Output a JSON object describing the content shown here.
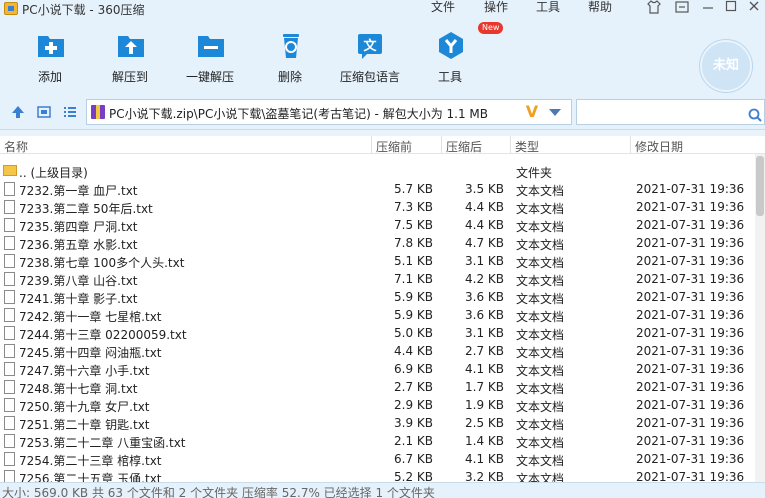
{
  "window": {
    "title": "PC小说下载 - 360压缩"
  },
  "menu": [
    "文件",
    "操作",
    "工具",
    "帮助"
  ],
  "toolbar": {
    "items": [
      {
        "label": "添加",
        "icon": "add-icon"
      },
      {
        "label": "解压到",
        "icon": "extract-to-icon"
      },
      {
        "label": "一键解压",
        "icon": "one-click-extract-icon"
      },
      {
        "label": "删除",
        "icon": "delete-icon"
      },
      {
        "label": "压缩包语言",
        "icon": "archive-language-icon"
      },
      {
        "label": "工具",
        "icon": "tools-icon",
        "badge": "New"
      }
    ],
    "unknown_label": "未知"
  },
  "path": {
    "text": "PC小说下载.zip\\PC小说下载\\盗墓笔记(考古笔记)  - 解包大小为 1.1 MB"
  },
  "columns": {
    "name": "名称",
    "size": "压缩前",
    "compressed": "压缩后",
    "type": "类型",
    "modified": "修改日期"
  },
  "files": [
    {
      "name": ".. (上级目录)",
      "size": "",
      "compressed": "",
      "type": "文件夹",
      "date": "",
      "kind": "folder"
    },
    {
      "name": "7232.第一章 血尸.txt",
      "size": "5.7 KB",
      "compressed": "3.5 KB",
      "type": "文本文档",
      "date": "2021-07-31 19:36",
      "kind": "file"
    },
    {
      "name": "7233.第二章 50年后.txt",
      "size": "7.3 KB",
      "compressed": "4.4 KB",
      "type": "文本文档",
      "date": "2021-07-31 19:36",
      "kind": "file"
    },
    {
      "name": "7235.第四章 尸洞.txt",
      "size": "7.5 KB",
      "compressed": "4.4 KB",
      "type": "文本文档",
      "date": "2021-07-31 19:36",
      "kind": "file"
    },
    {
      "name": "7236.第五章 水影.txt",
      "size": "7.8 KB",
      "compressed": "4.7 KB",
      "type": "文本文档",
      "date": "2021-07-31 19:36",
      "kind": "file"
    },
    {
      "name": "7238.第七章 100多个人头.txt",
      "size": "5.1 KB",
      "compressed": "3.1 KB",
      "type": "文本文档",
      "date": "2021-07-31 19:36",
      "kind": "file"
    },
    {
      "name": "7239.第八章 山谷.txt",
      "size": "7.1 KB",
      "compressed": "4.2 KB",
      "type": "文本文档",
      "date": "2021-07-31 19:36",
      "kind": "file"
    },
    {
      "name": "7241.第十章 影子.txt",
      "size": "5.9 KB",
      "compressed": "3.6 KB",
      "type": "文本文档",
      "date": "2021-07-31 19:36",
      "kind": "file"
    },
    {
      "name": "7242.第十一章 七星棺.txt",
      "size": "5.9 KB",
      "compressed": "3.6 KB",
      "type": "文本文档",
      "date": "2021-07-31 19:36",
      "kind": "file"
    },
    {
      "name": "7244.第十三章 02200059.txt",
      "size": "5.0 KB",
      "compressed": "3.1 KB",
      "type": "文本文档",
      "date": "2021-07-31 19:36",
      "kind": "file"
    },
    {
      "name": "7245.第十四章 闷油瓶.txt",
      "size": "4.4 KB",
      "compressed": "2.7 KB",
      "type": "文本文档",
      "date": "2021-07-31 19:36",
      "kind": "file"
    },
    {
      "name": "7247.第十六章 小手.txt",
      "size": "6.9 KB",
      "compressed": "4.1 KB",
      "type": "文本文档",
      "date": "2021-07-31 19:36",
      "kind": "file"
    },
    {
      "name": "7248.第十七章 洞.txt",
      "size": "2.7 KB",
      "compressed": "1.7 KB",
      "type": "文本文档",
      "date": "2021-07-31 19:36",
      "kind": "file"
    },
    {
      "name": "7250.第十九章 女尸.txt",
      "size": "2.9 KB",
      "compressed": "1.9 KB",
      "type": "文本文档",
      "date": "2021-07-31 19:36",
      "kind": "file"
    },
    {
      "name": "7251.第二十章 钥匙.txt",
      "size": "3.9 KB",
      "compressed": "2.5 KB",
      "type": "文本文档",
      "date": "2021-07-31 19:36",
      "kind": "file"
    },
    {
      "name": "7253.第二十二章 八重宝函.txt",
      "size": "2.1 KB",
      "compressed": "1.4 KB",
      "type": "文本文档",
      "date": "2021-07-31 19:36",
      "kind": "file"
    },
    {
      "name": "7254.第二十三章 棺椁.txt",
      "size": "6.7 KB",
      "compressed": "4.1 KB",
      "type": "文本文档",
      "date": "2021-07-31 19:36",
      "kind": "file"
    },
    {
      "name": "7256.第二十五章 玉俑.txt",
      "size": "5.2 KB",
      "compressed": "3.2 KB",
      "type": "文本文档",
      "date": "2021-07-31 19:36",
      "kind": "file"
    }
  ],
  "status": "大小: 569.0 KB 共 63 个文件和 2 个文件夹 压缩率 52.7% 已经选择 1 个文件夹",
  "colors": {
    "accent": "#1e88d8",
    "toolbar_bg": "#e6f2fb",
    "badge": "#e8372c"
  }
}
